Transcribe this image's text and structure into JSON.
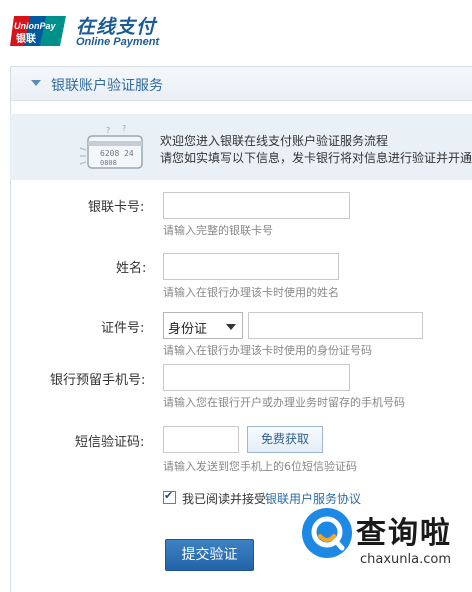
{
  "brand": {
    "badge_top": "UnionPay",
    "badge_bottom": "银联",
    "title": "在线支付",
    "subtitle": "Online Payment"
  },
  "panel": {
    "title": "银联账户验证服务"
  },
  "intro": {
    "card_number_graphic": "6208 24",
    "card_number_graphic_2": "0808",
    "line1": "欢迎您进入银联在线支付账户验证服务流程",
    "line2": "请您如实填写以下信息，发卡银行将对信息进行验证并开通服"
  },
  "form": {
    "card_number": {
      "label": "银联卡号:",
      "value": "",
      "hint": "请输入完整的银联卡号"
    },
    "name": {
      "label": "姓名:",
      "value": "",
      "hint": "请输入在银行办理该卡时使用的姓名"
    },
    "id_number": {
      "label": "证件号:",
      "id_type": "身份证",
      "value": "",
      "hint": "请输入在银行办理该卡时使用的身份证号码"
    },
    "phone": {
      "label": "银行预留手机号:",
      "value": "",
      "hint": "请输入您在银行开户或办理业务时留存的手机号码"
    },
    "sms_code": {
      "label": "短信验证码:",
      "value": "",
      "button": "免费获取",
      "hint": "请输入发送到您手机上的6位短信验证码"
    },
    "agreement": {
      "checked": true,
      "text": "我已阅读并接受",
      "link": "银联用户服务协议"
    },
    "submit": "提交验证"
  },
  "watermark": {
    "text": "查询啦",
    "domain": "chaxunla.com"
  },
  "colors": {
    "brand_blue": "#1b5b96",
    "unionpay_red": "#d7141a",
    "unionpay_blue": "#005a9e",
    "unionpay_green": "#00908c",
    "submit_blue": "#2263a8",
    "watermark_blue": "#1e88e5",
    "watermark_orange": "#f5a623"
  }
}
